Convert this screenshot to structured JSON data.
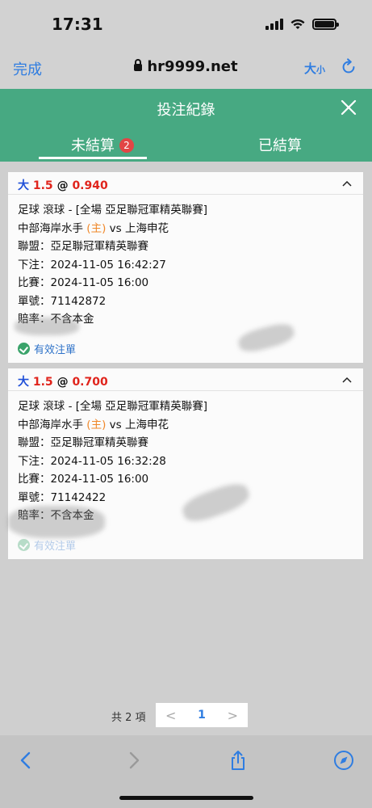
{
  "status_bar": {
    "time": "17:31"
  },
  "browser": {
    "done_label": "完成",
    "url": "hr9999.net",
    "text_size_big": "大",
    "text_size_small": "小"
  },
  "header": {
    "title": "投注紀錄"
  },
  "tabs": [
    {
      "label": "未結算",
      "badge": "2",
      "active": true
    },
    {
      "label": "已結算",
      "active": false
    }
  ],
  "bets": [
    {
      "pick": "大",
      "line": "1.5",
      "at": "@",
      "odds": "0.940",
      "market": "足球 滾球 - [全場 亞足聯冠軍精英聯賽]",
      "home_team": "中部海岸水手",
      "home_tag": "(主)",
      "vs": "vs",
      "away_team": "上海申花",
      "league": "聯盟：亞足聯冠軍精英聯賽",
      "placed": "下注：2024-11-05 16:42:27",
      "match_time": "比賽：2024-11-05 16:00",
      "ticket": "單號：71142872",
      "payout": "賠率：不含本金",
      "status": "有效注單"
    },
    {
      "pick": "大",
      "line": "1.5",
      "at": "@",
      "odds": "0.700",
      "market": "足球 滾球 - [全場 亞足聯冠軍精英聯賽]",
      "home_team": "中部海岸水手",
      "home_tag": "(主)",
      "vs": "vs",
      "away_team": "上海申花",
      "league": "聯盟：亞足聯冠軍精英聯賽",
      "placed": "下注：2024-11-05 16:32:28",
      "match_time": "比賽：2024-11-05 16:00",
      "ticket": "單號：71142422",
      "payout": "賠率：不含本金",
      "status": "有效注單"
    }
  ],
  "pagination": {
    "total": "共 2 項",
    "prev": "<",
    "current": "1",
    "next": ">"
  },
  "colors": {
    "header_green": "#47a982",
    "link_blue": "#2f7de1",
    "odds_red": "#e0241c",
    "badge_red": "#e24545"
  },
  "icons": [
    "lock-icon",
    "reload-icon",
    "close-icon",
    "chevron-up-icon",
    "check-circle-icon",
    "back-icon",
    "forward-icon",
    "share-icon",
    "compass-icon"
  ]
}
